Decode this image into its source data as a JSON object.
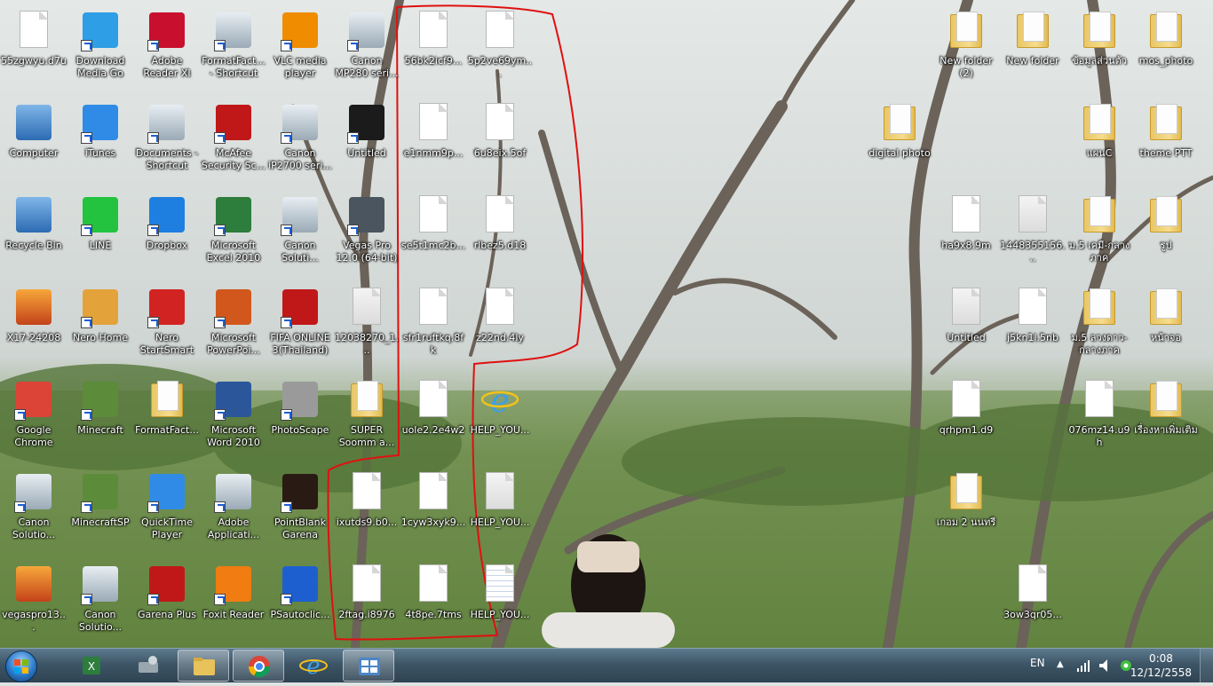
{
  "desktop": {
    "icons": [
      {
        "label": "55zgwyu.d7u",
        "type": "doc"
      },
      {
        "label": "Download Media Go",
        "type": "shortcut"
      },
      {
        "label": "Adobe Reader XI",
        "type": "shortcut"
      },
      {
        "label": "FormatFact... - Shortcut",
        "type": "shortcut"
      },
      {
        "label": "VLC media player",
        "type": "shortcut"
      },
      {
        "label": "Canon MP280 seri...",
        "type": "shortcut"
      },
      {
        "label": "56bk2icf9...",
        "type": "doc"
      },
      {
        "label": "5p2ve69ym...",
        "type": "doc"
      },
      {
        "label": "Computer",
        "type": "system"
      },
      {
        "label": "iTunes",
        "type": "shortcut"
      },
      {
        "label": "Documents - Shortcut",
        "type": "shortcut"
      },
      {
        "label": "McAfee Security Sc...",
        "type": "shortcut"
      },
      {
        "label": "Canon iP2700 seri...",
        "type": "shortcut"
      },
      {
        "label": "Untitled",
        "type": "shortcut"
      },
      {
        "label": "e1nmm9p...",
        "type": "doc"
      },
      {
        "label": "6u8eix.5of",
        "type": "doc"
      },
      {
        "label": "Recycle Bin",
        "type": "system"
      },
      {
        "label": "LINE",
        "type": "shortcut"
      },
      {
        "label": "Dropbox",
        "type": "shortcut"
      },
      {
        "label": "Microsoft Excel 2010",
        "type": "shortcut"
      },
      {
        "label": "Canon Soluti...",
        "type": "shortcut"
      },
      {
        "label": "Vegas Pro 12.0 (64-bit)",
        "type": "shortcut"
      },
      {
        "label": "se5t1mc2b...",
        "type": "doc"
      },
      {
        "label": "rlbez5.d18",
        "type": "doc"
      },
      {
        "label": "X17-24208",
        "type": "app"
      },
      {
        "label": "Nero Home",
        "type": "shortcut"
      },
      {
        "label": "Nero StartSmart",
        "type": "shortcut"
      },
      {
        "label": "Microsoft PowerPoi...",
        "type": "shortcut"
      },
      {
        "label": "FIFA ONLINE 3(Thailand)",
        "type": "shortcut"
      },
      {
        "label": "12038270_1...",
        "type": "image"
      },
      {
        "label": "sfr1ruftkq.8fk",
        "type": "doc"
      },
      {
        "label": "z22nd.4ly",
        "type": "doc"
      },
      {
        "label": "Google Chrome",
        "type": "shortcut"
      },
      {
        "label": "Minecraft",
        "type": "shortcut"
      },
      {
        "label": "FormatFact...",
        "type": "folder"
      },
      {
        "label": "Microsoft Word 2010",
        "type": "shortcut"
      },
      {
        "label": "PhotoScape",
        "type": "shortcut"
      },
      {
        "label": "SUPER Soomm a...",
        "type": "folder"
      },
      {
        "label": "uole2.2e4w2",
        "type": "doc"
      },
      {
        "label": "HELP_YOU...",
        "type": "html"
      },
      {
        "label": "Canon Solutio...",
        "type": "shortcut"
      },
      {
        "label": "MinecraftSP",
        "type": "shortcut"
      },
      {
        "label": "QuickTime Player",
        "type": "shortcut"
      },
      {
        "label": "Adobe Applicati...",
        "type": "shortcut"
      },
      {
        "label": "PointBlank Garena",
        "type": "shortcut"
      },
      {
        "label": "ixutds9.b0...",
        "type": "doc"
      },
      {
        "label": "1cyw3xyk9...",
        "type": "doc"
      },
      {
        "label": "HELP_YOU...",
        "type": "image"
      },
      {
        "label": "vegaspro13...",
        "type": "app"
      },
      {
        "label": "Canon Solutio...",
        "type": "shortcut"
      },
      {
        "label": "Garena Plus",
        "type": "shortcut"
      },
      {
        "label": "Foxit Reader",
        "type": "shortcut"
      },
      {
        "label": "PSautoclic...",
        "type": "shortcut"
      },
      {
        "label": "2ftag.i8976",
        "type": "doc"
      },
      {
        "label": "4t8pe.7tms",
        "type": "doc"
      },
      {
        "label": "HELP_YOU...",
        "type": "text"
      },
      {
        "label": "New folder (2)",
        "type": "folder"
      },
      {
        "label": "New folder",
        "type": "folder"
      },
      {
        "label": "ข้อมูลส่วนตัว",
        "type": "folder"
      },
      {
        "label": "mos_photo",
        "type": "folder"
      },
      {
        "label": "digital photo",
        "type": "folder"
      },
      {
        "label": "แผนC",
        "type": "folder"
      },
      {
        "label": "theme PTT",
        "type": "folder"
      },
      {
        "label": "ha9x8.9m",
        "type": "doc"
      },
      {
        "label": "1448355156...",
        "type": "image"
      },
      {
        "label": "ม.5 เคมี-กลางภาค",
        "type": "folder"
      },
      {
        "label": "รูป",
        "type": "folder"
      },
      {
        "label": "Untitled",
        "type": "image"
      },
      {
        "label": "j5kn1l.5nb",
        "type": "doc"
      },
      {
        "label": "ม.5 ลวงดาว-กลางภาค",
        "type": "folder"
      },
      {
        "label": "หน้าจอ",
        "type": "folder"
      },
      {
        "label": "qrhpm1.d9",
        "type": "doc"
      },
      {
        "label": "076mz14.u9h",
        "type": "doc"
      },
      {
        "label": "เรื่องหาเพิ่มเติม",
        "type": "folder"
      },
      {
        "label": "เกอม 2 นนทรี",
        "type": "folder"
      },
      {
        "label": "3ow3qr05...",
        "type": "doc"
      }
    ]
  },
  "taskbar": {
    "pinned": [
      "Microsoft Excel",
      "Network",
      "Windows Explorer",
      "Google Chrome",
      "Internet Explorer",
      "Control Panel"
    ],
    "language": "EN",
    "time": "0:08",
    "date": "12/12/2558"
  }
}
